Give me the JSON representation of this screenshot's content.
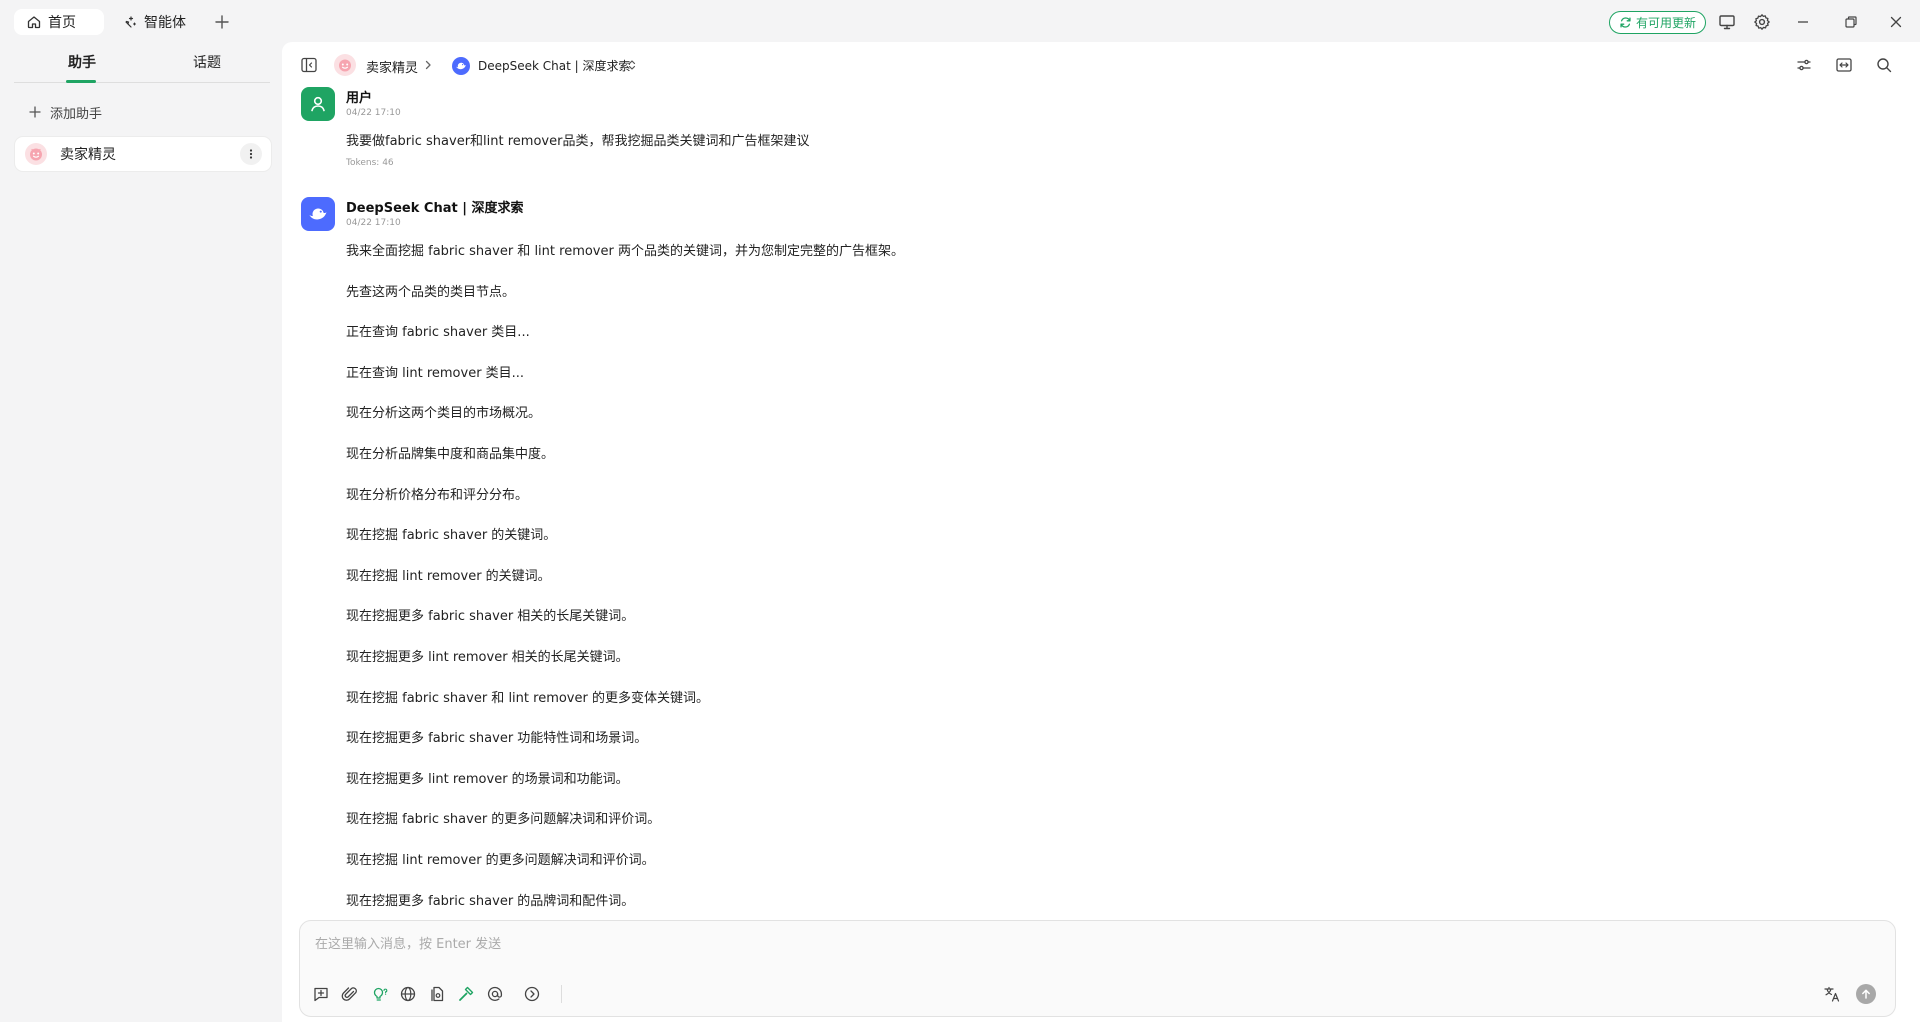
{
  "topbar": {
    "tabs": [
      {
        "label": "首页",
        "icon": "home-icon"
      },
      {
        "label": "智能体",
        "icon": "sparkle-icon"
      }
    ],
    "update_label": "有可用更新",
    "icons": [
      "monitor-icon",
      "gear-icon",
      "minimize-icon",
      "restore-icon",
      "close-icon"
    ]
  },
  "sidebar": {
    "tabs": [
      {
        "label": "助手",
        "active": true
      },
      {
        "label": "话题",
        "active": false
      }
    ],
    "add_label": "添加助手",
    "assistants": [
      {
        "label": "卖家精灵",
        "icon": "seller-elf-avatar"
      }
    ]
  },
  "header": {
    "assistant_name": "卖家精灵",
    "model_name": "DeepSeek Chat | 深度求索"
  },
  "messages": [
    {
      "author": "用户",
      "time": "04/22 17:10",
      "text": "我要做fabric shaver和lint remover品类，帮我挖掘品类关键词和广告框架建议",
      "tokens": "Tokens: 46"
    },
    {
      "author": "DeepSeek Chat | 深度求索",
      "time": "04/22 17:10",
      "paragraphs": [
        "我来全面挖掘 fabric shaver 和 lint remover 两个品类的关键词，并为您制定完整的广告框架。",
        "先查这两个品类的类目节点。",
        "正在查询 fabric shaver 类目...",
        "正在查询 lint remover 类目...",
        "现在分析这两个类目的市场概况。",
        "现在分析品牌集中度和商品集中度。",
        "现在分析价格分布和评分分布。",
        "现在挖掘 fabric shaver 的关键词。",
        "现在挖掘 lint remover 的关键词。",
        "现在挖掘更多 fabric shaver 相关的长尾关键词。",
        "现在挖掘更多 lint remover 相关的长尾关键词。",
        "现在挖掘 fabric shaver 和 lint remover 的更多变体关键词。",
        "现在挖掘更多 fabric shaver 功能特性词和场景词。",
        "现在挖掘更多 lint remover 的场景词和功能词。",
        "现在挖掘 fabric shaver 的更多问题解决词和评价词。",
        "现在挖掘 lint remover 的更多问题解决词和评价词。",
        "现在挖掘更多 fabric shaver 的品牌词和配件词。"
      ]
    }
  ],
  "input": {
    "placeholder": "在这里输入消息，按 Enter 发送",
    "tools": [
      "new-topic-icon",
      "attachment-icon",
      "reasoning-bulb-icon",
      "web-search-icon",
      "knowledge-base-icon",
      "mcp-tools-icon",
      "mention-model-icon",
      "more-icon"
    ],
    "right_tools": [
      "translate-icon",
      "send-icon"
    ]
  },
  "colors": {
    "accent": "#1fa463",
    "deepseek": "#4d6bfe",
    "user_avatar": "#1fa463"
  }
}
